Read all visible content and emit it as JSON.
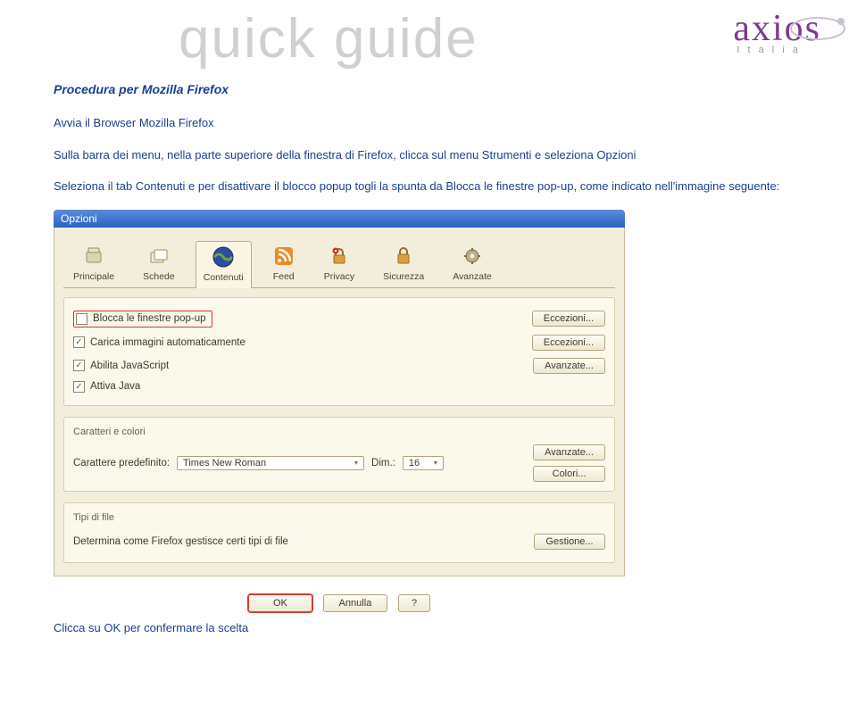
{
  "watermark": "quick guide",
  "brand": {
    "name": "axios",
    "sub": "I  t  a  l  i  a"
  },
  "heading": "Procedura per Mozilla Firefox",
  "intro_lines": [
    "Avvia il Browser Mozilla Firefox",
    "Sulla barra dei menu, nella parte superiore della finestra di Firefox, clicca sul menu Strumenti e seleziona Opzioni",
    "Seleziona il tab Contenuti e per disattivare il blocco popup togli la spunta da Blocca le finestre pop-up, come indicato nell'immagine seguente:"
  ],
  "dialog": {
    "title": "Opzioni",
    "tabs": [
      {
        "label": "Principale",
        "icon": "gear-icon"
      },
      {
        "label": "Schede",
        "icon": "tabs-icon"
      },
      {
        "label": "Contenuti",
        "icon": "globe-icon"
      },
      {
        "label": "Feed",
        "icon": "rss-icon"
      },
      {
        "label": "Privacy",
        "icon": "lock-icon"
      },
      {
        "label": "Sicurezza",
        "icon": "shield-icon"
      },
      {
        "label": "Avanzate",
        "icon": "cog-icon"
      }
    ],
    "active_tab": 2,
    "options": [
      {
        "label": "Blocca le finestre pop-up",
        "checked": false,
        "action": "Eccezioni...",
        "highlight": true
      },
      {
        "label": "Carica immagini automaticamente",
        "checked": true,
        "action": "Eccezioni..."
      },
      {
        "label": "Abilita JavaScript",
        "checked": true,
        "action": "Avanzate..."
      },
      {
        "label": "Attiva Java",
        "checked": true,
        "action": null
      }
    ],
    "fonts_group": {
      "title": "Caratteri e colori",
      "default_font_label": "Carattere predefinito:",
      "default_font_value": "Times New Roman",
      "size_label": "Dim.:",
      "size_value": "16",
      "advanced_btn": "Avanzate...",
      "colors_btn": "Colori..."
    },
    "types_group": {
      "title": "Tipi di file",
      "desc": "Determina come Firefox gestisce certi tipi di file",
      "manage_btn": "Gestione..."
    },
    "buttons": {
      "ok": "OK",
      "cancel": "Annulla",
      "help": "?"
    }
  },
  "footnote": "Clicca su OK per confermare la scelta"
}
